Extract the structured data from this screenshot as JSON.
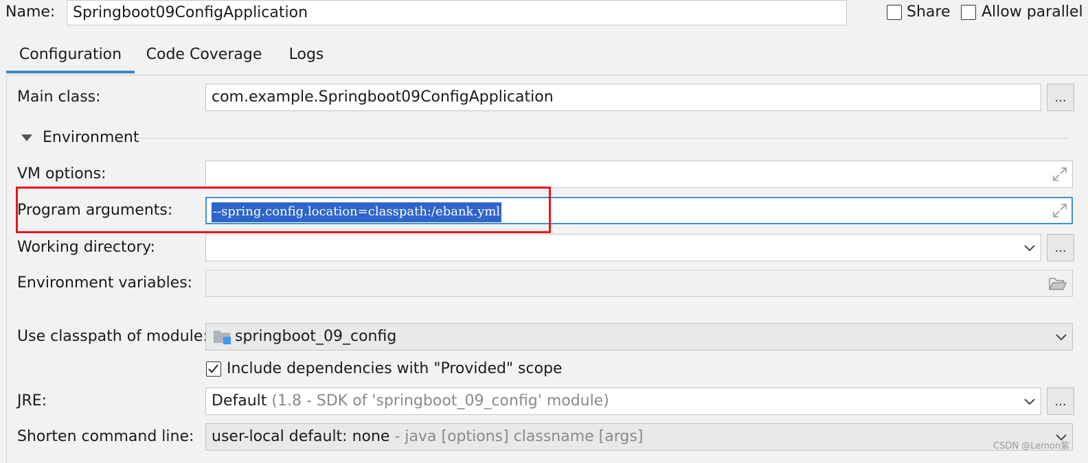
{
  "name_row": {
    "label": "Name:",
    "value": "Springboot09ConfigApplication",
    "share_label": "Share",
    "share_checked": false,
    "allow_parallel_label": "Allow parallel",
    "allow_parallel_checked": false
  },
  "tabs": [
    {
      "label": "Configuration",
      "active": true
    },
    {
      "label": "Code Coverage",
      "active": false
    },
    {
      "label": "Logs",
      "active": false
    }
  ],
  "form": {
    "main_class": {
      "label": "Main class:",
      "value": "com.example.Springboot09ConfigApplication",
      "button": "..."
    },
    "environment_section": {
      "label": "Environment",
      "expanded": true
    },
    "vm_options": {
      "label": "VM options:",
      "value": ""
    },
    "program_arguments": {
      "label": "Program arguments:",
      "value": "--spring.config.location=classpath:/ebank.yml",
      "selected": true
    },
    "working_directory": {
      "label": "Working directory:",
      "value": "",
      "button": "..."
    },
    "environment_variables": {
      "label": "Environment variables:",
      "value": ""
    },
    "classpath_module": {
      "label": "Use classpath of module:",
      "value": "springboot_09_config"
    },
    "include_provided": {
      "label": "Include dependencies with \"Provided\" scope",
      "checked": true
    },
    "jre": {
      "label": "JRE:",
      "value": "Default",
      "hint": "(1.8 - SDK of 'springboot_09_config' module)",
      "button": "..."
    },
    "shorten_command_line": {
      "label": "Shorten command line:",
      "value": "user-local default: none",
      "hint": "- java [options] classname [args]"
    }
  },
  "watermark": "CSDN @Lemon紫",
  "colors": {
    "accent": "#4083c9",
    "selection": "#2f65ca",
    "highlight_box": "#e8141e",
    "background": "#f2f2f2"
  }
}
